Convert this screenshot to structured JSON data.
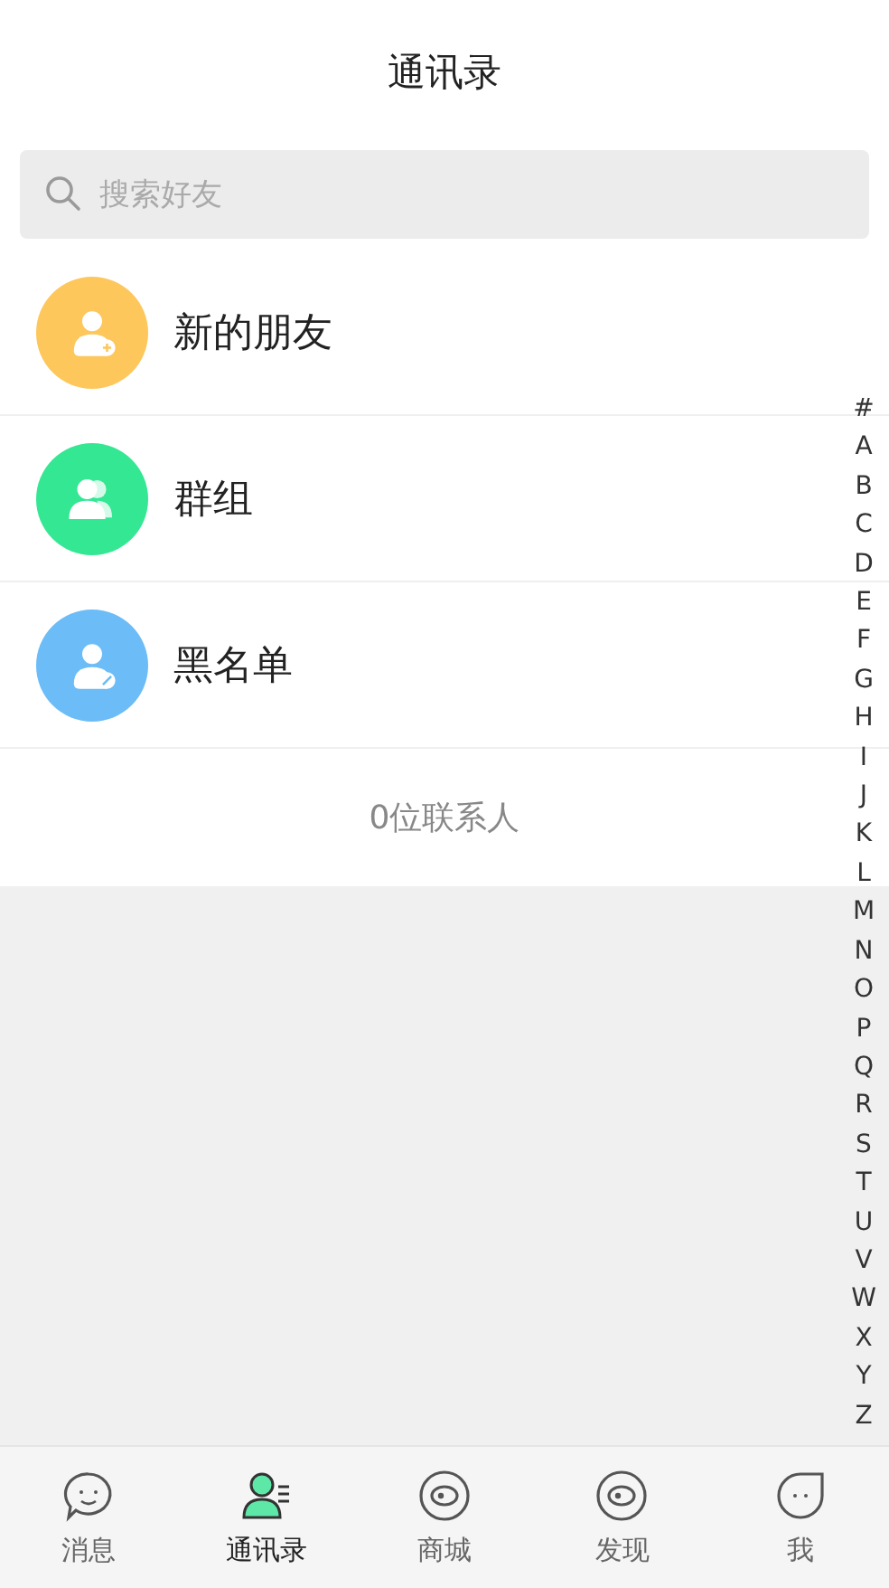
{
  "header": {
    "title": "通讯录"
  },
  "search": {
    "placeholder": "搜索好友"
  },
  "entries": [
    {
      "kind": "add",
      "label": "新的朋友",
      "color": "#fdc75c"
    },
    {
      "kind": "group",
      "label": "群组",
      "color": "#33e793"
    },
    {
      "kind": "block",
      "label": "黑名单",
      "color": "#6cbcf8"
    }
  ],
  "contact_count": "0位联系人",
  "index_letters": [
    "#",
    "A",
    "B",
    "C",
    "D",
    "E",
    "F",
    "G",
    "H",
    "I",
    "J",
    "K",
    "L",
    "M",
    "N",
    "O",
    "P",
    "Q",
    "R",
    "S",
    "T",
    "U",
    "V",
    "W",
    "X",
    "Y",
    "Z"
  ],
  "tabs": [
    {
      "kind": "chat",
      "label": "消息",
      "selected": false
    },
    {
      "kind": "contacts",
      "label": "通讯录",
      "selected": true
    },
    {
      "kind": "eye",
      "label": "商城",
      "selected": false
    },
    {
      "kind": "eye",
      "label": "发现",
      "selected": false
    },
    {
      "kind": "drop",
      "label": "我",
      "selected": false
    }
  ]
}
